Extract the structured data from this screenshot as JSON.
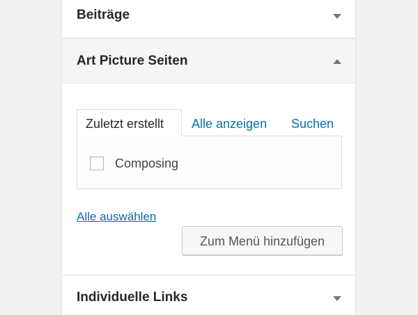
{
  "sections": {
    "beitraege": {
      "title": "Beiträge",
      "expanded": false
    },
    "art_picture": {
      "title": "Art Picture Seiten",
      "expanded": true,
      "tabs": [
        {
          "label": "Zuletzt erstellt",
          "active": true
        },
        {
          "label": "Alle anzeigen",
          "active": false
        },
        {
          "label": "Suchen",
          "active": false
        }
      ],
      "items": [
        {
          "label": "Composing",
          "checked": false
        }
      ],
      "select_all_label": "Alle auswählen",
      "add_button_label": "Zum Menü hinzufügen"
    },
    "individuelle_links": {
      "title": "Individuelle Links",
      "expanded": false
    }
  },
  "colors": {
    "link": "#0073aa",
    "page_background": "#f1f1f1",
    "panel_background": "#ffffff",
    "active_header_background": "#f5f5f5"
  },
  "icons": {
    "collapsed": "arrow-down-icon",
    "expanded": "arrow-up-icon"
  }
}
